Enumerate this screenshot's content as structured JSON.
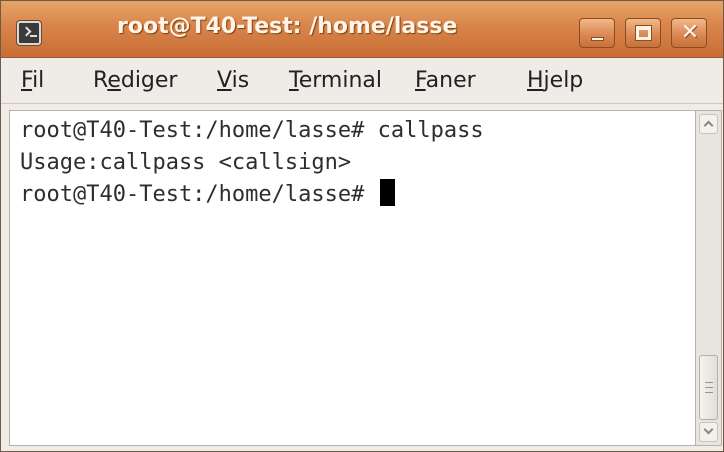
{
  "window": {
    "title": "root@T40-Test: /home/lasse",
    "app_icon": "terminal-icon",
    "buttons": {
      "minimize": "minimize-icon",
      "maximize": "maximize-icon",
      "close_glyph": "✕"
    }
  },
  "menu": {
    "items": [
      {
        "acc": "F",
        "rest": "il"
      },
      {
        "pre": "R",
        "acc": "e",
        "rest": "diger"
      },
      {
        "acc": "V",
        "rest": "is"
      },
      {
        "acc": "T",
        "rest": "erminal"
      },
      {
        "acc": "F",
        "rest": "aner"
      },
      {
        "acc": "H",
        "rest": "jelp"
      }
    ]
  },
  "terminal": {
    "lines": [
      "root@T40-Test:/home/lasse# callpass",
      "Usage:callpass <callsign>",
      "root@T40-Test:/home/lasse# "
    ]
  },
  "colors": {
    "titlebar": "#d8844a",
    "title_text": "#fff4e6",
    "window_bg": "#efebe7",
    "terminal_bg": "#ffffff",
    "terminal_fg": "#2e2e2e",
    "cursor": "#000000"
  }
}
